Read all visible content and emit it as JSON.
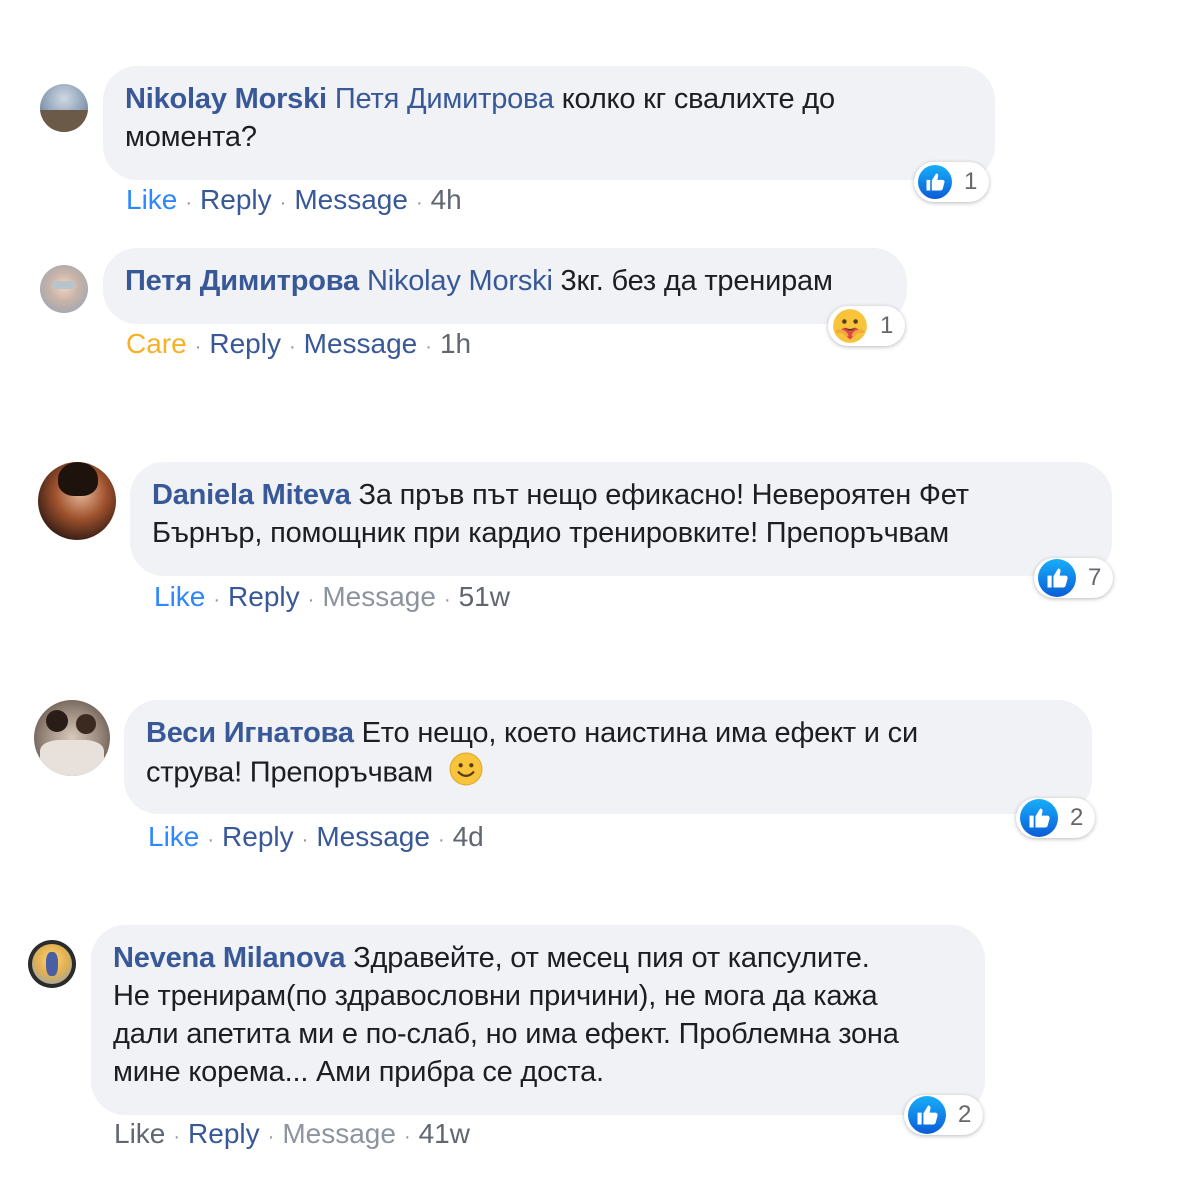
{
  "comments": [
    {
      "author": "Nikolay Morski",
      "tag": "Петя Димитрова",
      "text_line1": " колко кг свалихте до",
      "text_line2": "момента?",
      "actions": {
        "like": "Like",
        "reply": "Reply",
        "message": "Message",
        "time": "4h"
      },
      "reaction": {
        "type": "like",
        "count": "1"
      }
    },
    {
      "author": "Петя Димитрова",
      "tag": "Nikolay Morski",
      "text_line1": " 3кг. без да тренирам",
      "actions": {
        "like": "Care",
        "reply": "Reply",
        "message": "Message",
        "time": "1h"
      },
      "reaction": {
        "type": "care",
        "count": "1"
      }
    },
    {
      "author": "Daniela Miteva",
      "text_line1": " За пръв път нещо ефикасно! Невероятен Фет",
      "text_line2": "Бърнър, помощник при кардио тренировките! Препоръчвам",
      "actions": {
        "like": "Like",
        "reply": "Reply",
        "message": "Message",
        "time": "51w"
      },
      "reaction": {
        "type": "like",
        "count": "7"
      }
    },
    {
      "author": "Веси Игнатова",
      "text_line1": " Ето нещо, което наистина има ефект и си",
      "text_line2": "струва! Препоръчвам",
      "actions": {
        "like": "Like",
        "reply": "Reply",
        "message": "Message",
        "time": "4d"
      },
      "reaction": {
        "type": "like",
        "count": "2"
      }
    },
    {
      "author": "Nevena Milanova",
      "text_line1": " Здравейте, от месец пия от капсулите.",
      "text_line2": "Не тренирам(по здравословни причини), не мога да кажа",
      "text_line3": "дали апетита ми е по-слаб, но има ефект. Проблемна зона",
      "text_line4": "мине корема... Ами прибра се доста.",
      "actions": {
        "like": "Like",
        "reply": "Reply",
        "message": "Message",
        "time": "41w"
      },
      "reaction": {
        "type": "like",
        "count": "2"
      }
    }
  ],
  "colors": {
    "author": "#385898",
    "bubble": "#f0f2f5",
    "like_blue": "#2d88ff",
    "care_yellow": "#f7b125"
  }
}
